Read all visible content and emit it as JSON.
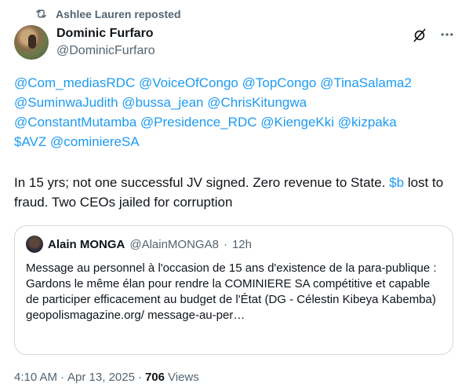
{
  "repost": {
    "icon": "repost-icon",
    "label": "Ashlee Lauren reposted"
  },
  "author": {
    "name": "Dominic Furfaro",
    "handle": "@DominicFurfaro"
  },
  "mentions": [
    "@Com_mediasRDC",
    "@VoiceOfCongo",
    "@TopCongo",
    "@TinaSalama2",
    "@SuminwaJudith",
    "@bussa_jean",
    "@ChrisKitungwa",
    "@ConstantMutamba",
    "@Presidence_RDC",
    "@KiengeKki",
    "@kizpaka",
    "$AVZ",
    "@cominiereSA"
  ],
  "reply": {
    "part1": "In 15 yrs; not one successful JV signed. Zero revenue to State.",
    "cashtag": "$b",
    "part2": "lost to fraud. Two CEOs jailed for corruption"
  },
  "quote": {
    "name": "Alain MONGA",
    "handle": "@AlainMONGA8",
    "separator": "·",
    "time": "12h",
    "text": "Message au personnel à l'occasion de 15 ans d'existence de la para-publique : Gardons le même élan pour rendre la COMINIERE SA compétitive et capable de participer efficacement au budget de l'État (DG - Célestin Kibeya Kabemba) geopolismagazine.org/ message-au-per…"
  },
  "footer": {
    "time": "4:10 AM",
    "sep1": "·",
    "date": "Apr 13, 2025",
    "sep2": "·",
    "views_count": "706",
    "views_label": "Views"
  },
  "colors": {
    "link": "#1d9bf0",
    "muted": "#536471",
    "text": "#0f1419",
    "border": "#cfd9de"
  }
}
